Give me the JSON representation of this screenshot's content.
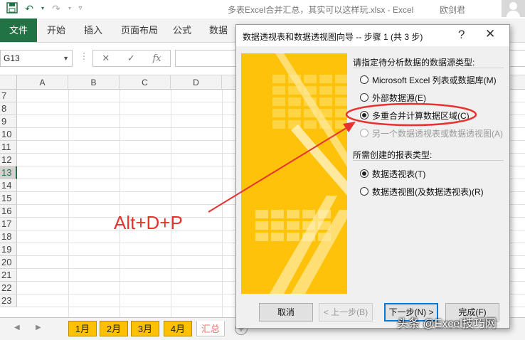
{
  "window": {
    "title": "多表Excel合并汇总，其实可以这样玩.xlsx  -  Excel",
    "user": "欧剑君"
  },
  "ribbon": {
    "tabs": [
      "文件",
      "开始",
      "插入",
      "页面布局",
      "公式",
      "数据"
    ]
  },
  "formula_bar": {
    "name_box": "G13",
    "value": ""
  },
  "grid": {
    "columns": [
      "A",
      "B",
      "C",
      "D"
    ],
    "rows": [
      "7",
      "8",
      "9",
      "10",
      "11",
      "12",
      "13",
      "14",
      "15",
      "16",
      "17",
      "18",
      "19",
      "20",
      "21",
      "22",
      "23"
    ],
    "active_row": "13"
  },
  "annotation": {
    "shortcut": "Alt+D+P",
    "color": "#e8322f"
  },
  "sheets": {
    "tabs": [
      "1月",
      "2月",
      "3月",
      "4月",
      "汇总"
    ],
    "active": "汇总",
    "tab_color": "#ffc000"
  },
  "dialog": {
    "title": "数据透视表和数据透视图向导 -- 步骤 1 (共 3 步)",
    "help": "?",
    "close": "✕",
    "source_group_label": "请指定待分析数据的数据源类型:",
    "source_options": [
      {
        "label": "Microsoft Excel 列表或数据库(M)",
        "selected": false,
        "enabled": true
      },
      {
        "label": "外部数据源(E)",
        "selected": false,
        "enabled": true
      },
      {
        "label": "多重合并计算数据区域(C)",
        "selected": true,
        "enabled": true
      },
      {
        "label": "另一个数据透视表或数据透视图(A)",
        "selected": false,
        "enabled": false
      }
    ],
    "report_group_label": "所需创建的报表类型:",
    "report_options": [
      {
        "label": "数据透视表(T)",
        "selected": true
      },
      {
        "label": "数据透视图(及数据透视表)(R)",
        "selected": false
      }
    ],
    "buttons": {
      "cancel": "取消",
      "back": "< 上一步(B)",
      "next": "下一步(N) >",
      "finish": "完成(F)"
    }
  },
  "watermark": "头条 @Excel技巧网"
}
